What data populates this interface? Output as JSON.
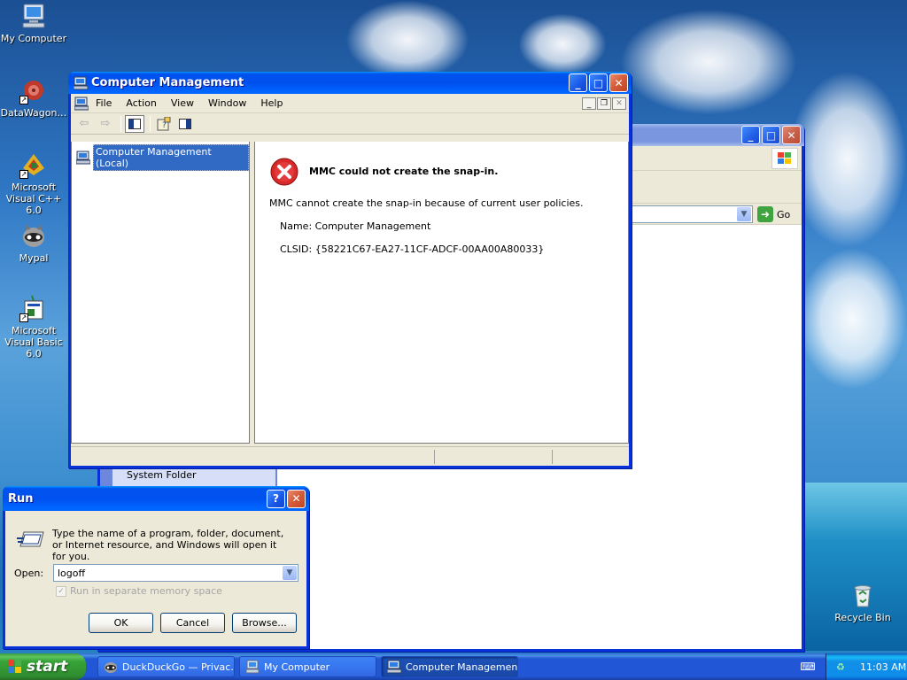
{
  "desktop": {
    "icons": [
      {
        "label": "My Computer",
        "icon": "my-computer-icon"
      },
      {
        "label": "DataWagon…",
        "icon": "datawagon-icon"
      },
      {
        "label": "Microsoft Visual C++ 6.0",
        "icon": "visual-cpp-icon"
      },
      {
        "label": "Mypal",
        "icon": "mypal-icon"
      },
      {
        "label": "Microsoft Visual Basic 6.0",
        "icon": "visual-basic-icon"
      },
      {
        "label": "Recycle Bin",
        "icon": "recycle-bin-icon"
      }
    ]
  },
  "background_window": {
    "go_label": "Go",
    "system_folder": "System Folder"
  },
  "computer_management": {
    "title": "Computer Management",
    "menu": [
      "File",
      "Action",
      "View",
      "Window",
      "Help"
    ],
    "tree_item": "Computer Management (Local)",
    "error": {
      "heading": "MMC could not create the snap-in.",
      "message": "MMC cannot create the snap-in because of current user policies.",
      "name_line": "Name: Computer Management",
      "clsid_line": "CLSID: {58221C67-EA27-11CF-ADCF-00AA00A80033}"
    }
  },
  "run_dialog": {
    "title": "Run",
    "description": "Type the name of a program, folder, document, or Internet resource, and Windows will open it for you.",
    "open_label": "Open:",
    "open_value": "logoff",
    "checkbox_label": "Run in separate memory space",
    "ok": "OK",
    "cancel": "Cancel",
    "browse": "Browse..."
  },
  "taskbar": {
    "start": "start",
    "tasks": [
      {
        "label": "DuckDuckGo — Privac…",
        "icon": "mypal-icon"
      },
      {
        "label": "My Computer",
        "icon": "my-computer-icon"
      },
      {
        "label": "Computer Management",
        "icon": "computer-management-icon",
        "active": true
      }
    ],
    "clock": "11:03 AM"
  },
  "colors": {
    "xp_blue": "#0054e3",
    "error_red": "#d8292a",
    "selection": "#316ac5"
  }
}
